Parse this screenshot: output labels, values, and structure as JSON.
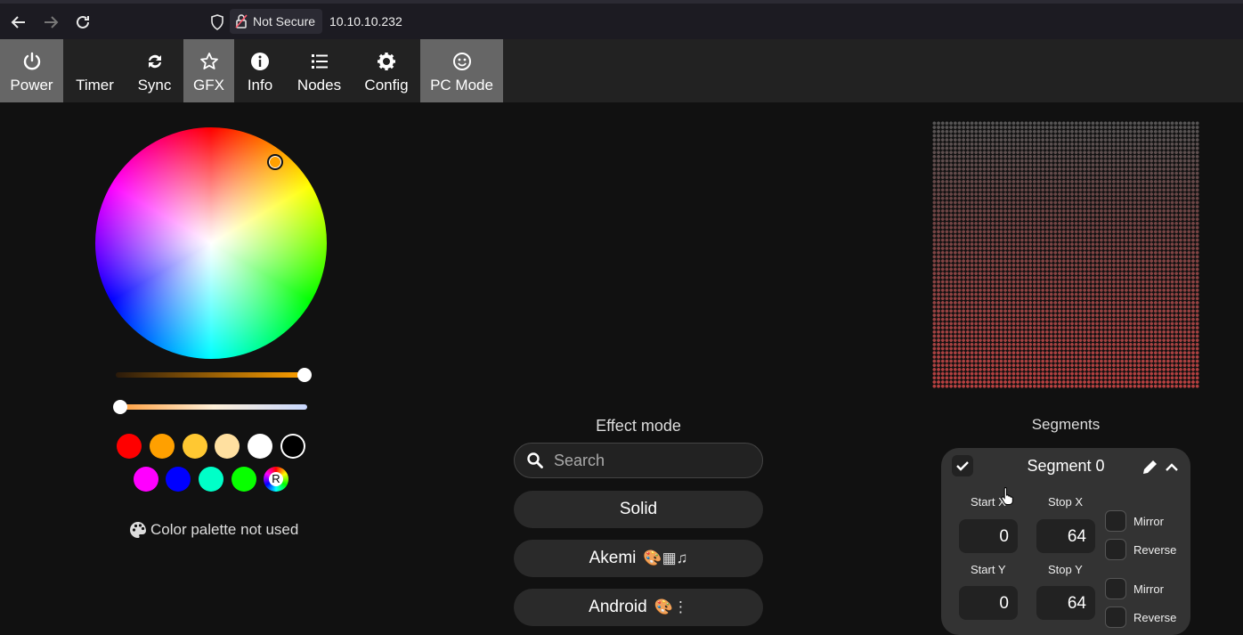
{
  "browser": {
    "security_label": "Not Secure",
    "url": "10.10.10.232"
  },
  "tabs": [
    {
      "label": "Power",
      "icon": "power-icon",
      "active": true
    },
    {
      "label": "Timer",
      "icon": "moon-icon",
      "active": false
    },
    {
      "label": "Sync",
      "icon": "sync-icon",
      "active": false
    },
    {
      "label": "GFX",
      "icon": "star-icon",
      "active": true
    },
    {
      "label": "Info",
      "icon": "info-icon",
      "active": false
    },
    {
      "label": "Nodes",
      "icon": "list-icon",
      "active": false
    },
    {
      "label": "Config",
      "icon": "gear-icon",
      "active": false
    },
    {
      "label": "PC Mode",
      "icon": "smiley-icon",
      "active": true
    }
  ],
  "color": {
    "selected_hex": "#ffa000",
    "brightness_slider": 1.0,
    "white_slider": 0.0,
    "swatches_row1": [
      "#ff0000",
      "#ffa000",
      "#ffc832",
      "#ffe0a0",
      "#ffffff",
      "#000000"
    ],
    "swatches_row2": [
      "#ff00ff",
      "#0000ff",
      "#00ffc8",
      "#08ff00"
    ],
    "random_label": "R",
    "palette_note": "Color palette not used"
  },
  "effects": {
    "title": "Effect mode",
    "search_placeholder": "Search",
    "items": [
      {
        "name": "Solid",
        "icons": ""
      },
      {
        "name": "Akemi",
        "icons": "🎨▦♫"
      },
      {
        "name": "Android",
        "icons": "🎨⋮"
      }
    ]
  },
  "segments": {
    "title": "Segments",
    "segment": {
      "name": "Segment 0",
      "start_x_label": "Start X",
      "stop_x_label": "Stop X",
      "start_y_label": "Start Y",
      "stop_y_label": "Stop Y",
      "start_x": "0",
      "stop_x": "64",
      "start_y": "0",
      "stop_y": "64",
      "mirror_label": "Mirror",
      "reverse_label": "Reverse"
    }
  }
}
